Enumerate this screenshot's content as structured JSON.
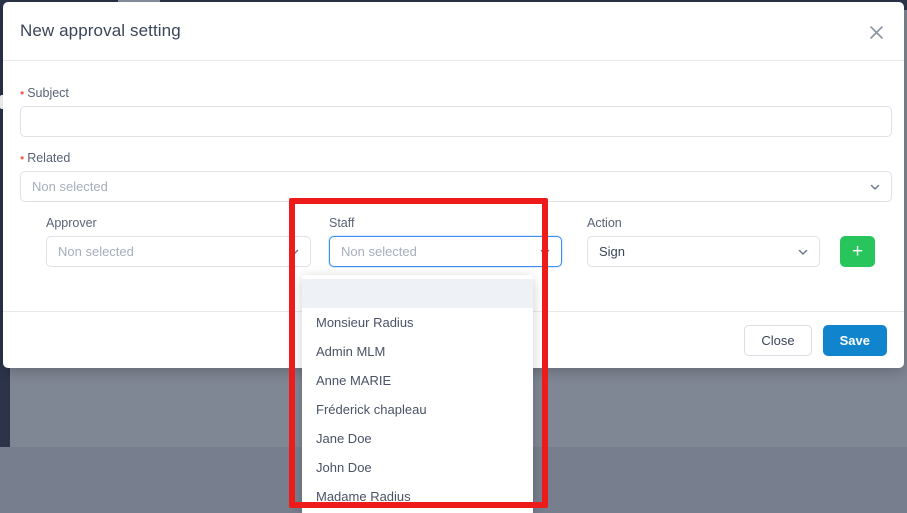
{
  "modal": {
    "title": "New approval setting",
    "close_icon": "close-icon"
  },
  "fields": {
    "subject": {
      "label": "Subject",
      "required_marker": "•",
      "value": "",
      "placeholder": ""
    },
    "related": {
      "label": "Related",
      "required_marker": "•",
      "value": "Non selected"
    },
    "approver": {
      "label": "Approver",
      "value": "Non selected"
    },
    "staff": {
      "label": "Staff",
      "value": "Non selected"
    },
    "action": {
      "label": "Action",
      "value": "Sign"
    }
  },
  "add_row_button": {
    "label": "+"
  },
  "staff_dropdown": {
    "open": true,
    "options": [
      "",
      "Monsieur Radius",
      "Admin MLM",
      "Anne MARIE",
      "Fréderick chapleau",
      "Jane Doe",
      "John Doe",
      "Madame Radius"
    ]
  },
  "footer": {
    "close_label": "Close",
    "save_label": "Save"
  },
  "colors": {
    "accent_blue": "#1085cd",
    "focus_blue": "#3b8ff0",
    "add_green": "#28c45c",
    "required_red": "#f0604d",
    "annotation_red": "#ee1b1b",
    "backdrop": "#7f8694",
    "title_text": "#3b4559"
  }
}
